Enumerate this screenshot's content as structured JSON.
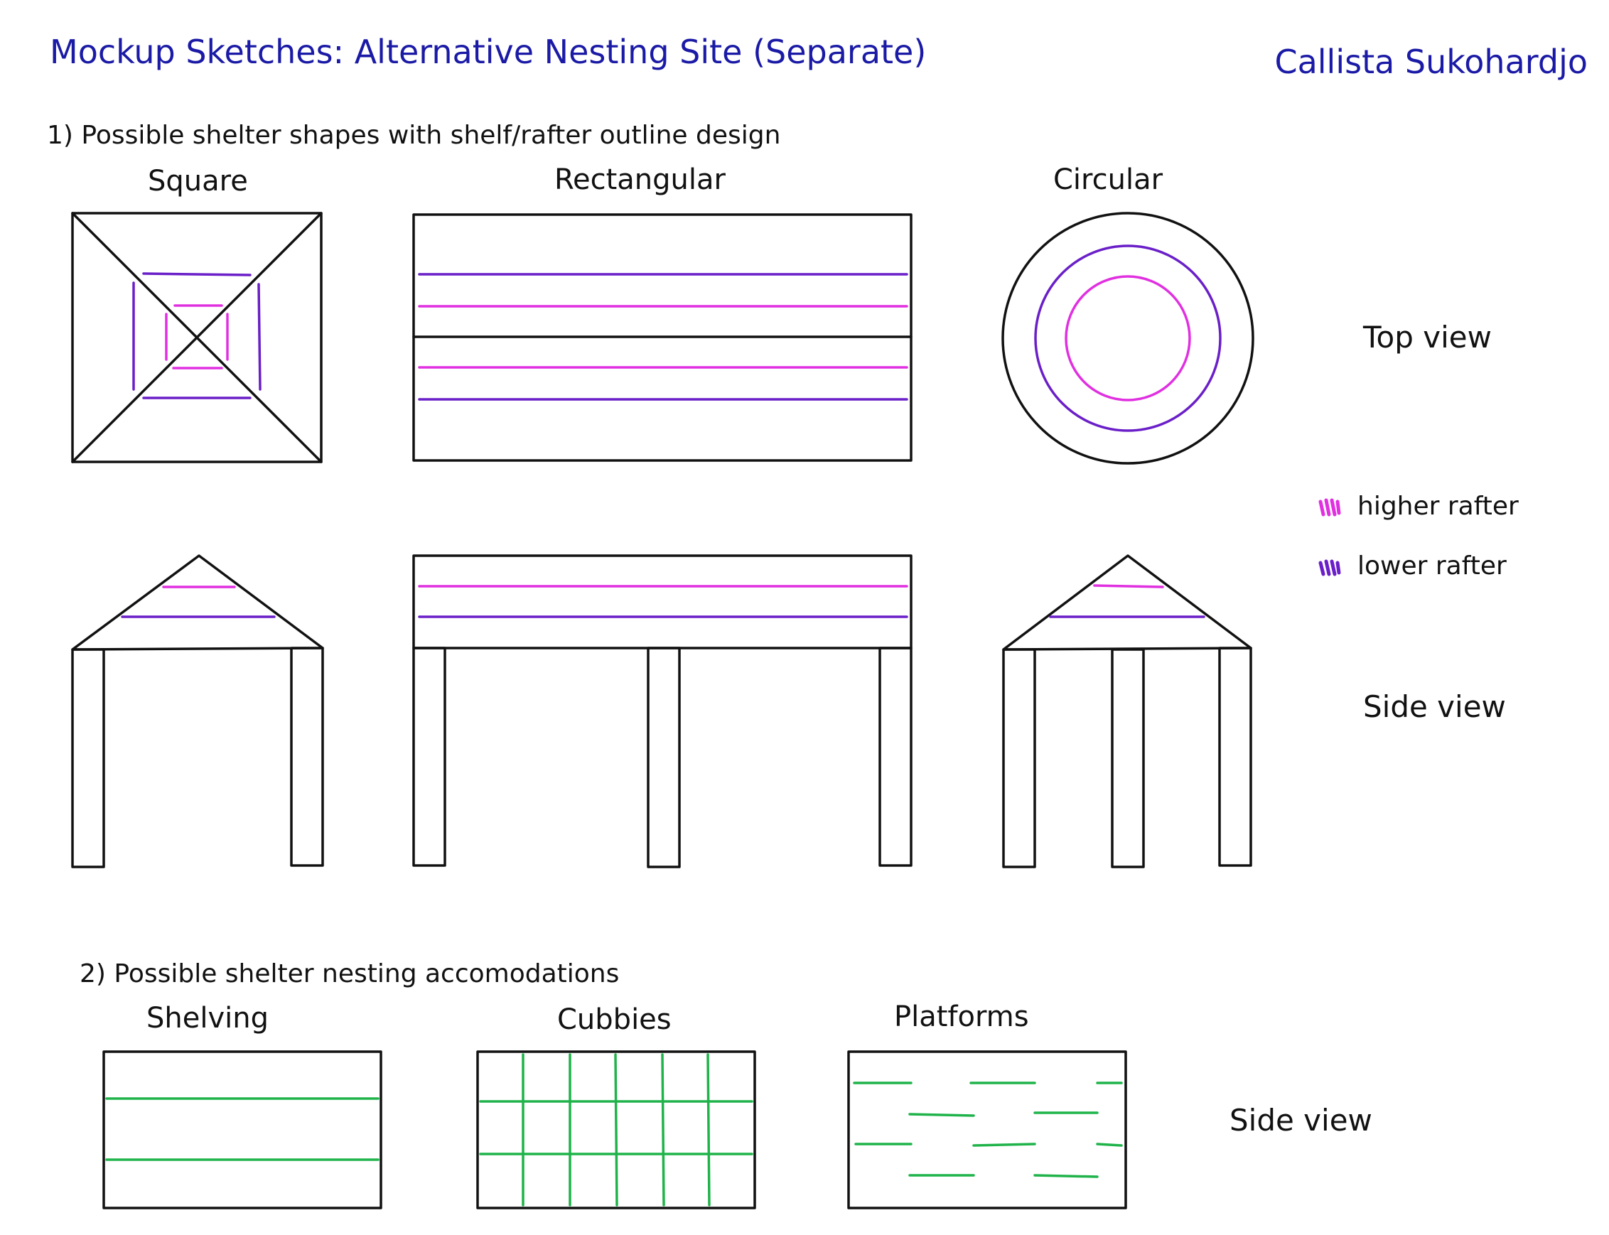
{
  "title": "Mockup Sketches: Alternative Nesting Site (Separate)",
  "author": "Callista Sukohardjo",
  "section1": {
    "heading": "1) Possible shelter shapes with shelf/rafter outline design",
    "shapes": [
      "Square",
      "Rectangular",
      "Circular"
    ],
    "top_view_label": "Top view",
    "side_view_label": "Side view"
  },
  "legend": {
    "higher": "higher rafter",
    "lower": "lower rafter"
  },
  "section2": {
    "heading": "2) Possible shelter nesting accomodations",
    "items": [
      "Shelving",
      "Cubbies",
      "Platforms"
    ],
    "side_view_label": "Side view"
  },
  "colors": {
    "ink": "#111111",
    "title": "#1a1aa6",
    "higher_rafter": "#e030e0",
    "lower_rafter": "#6a1fc8",
    "nest": "#1fb34a"
  }
}
